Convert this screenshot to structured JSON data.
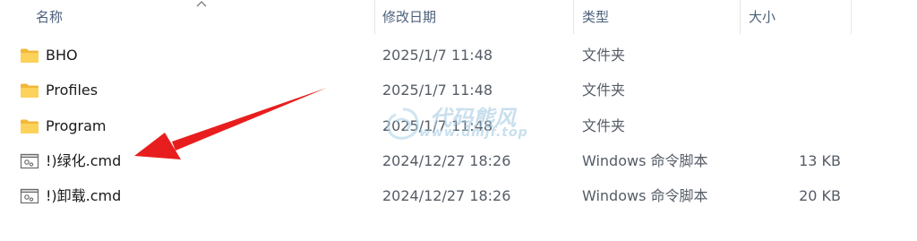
{
  "columns": {
    "name": "名称",
    "modified": "修改日期",
    "type": "类型",
    "size": "大小"
  },
  "files": [
    {
      "name": "BHO",
      "modified": "2025/1/7 11:48",
      "type": "文件夹",
      "size": "",
      "icon": "folder-icon"
    },
    {
      "name": "Profiles",
      "modified": "2025/1/7 11:48",
      "type": "文件夹",
      "size": "",
      "icon": "folder-icon"
    },
    {
      "name": "Program",
      "modified": "2025/1/7 11:48",
      "type": "文件夹",
      "size": "",
      "icon": "folder-icon"
    },
    {
      "name": "!)绿化.cmd",
      "modified": "2024/12/27 18:26",
      "type": "Windows 命令脚本",
      "size": "13 KB",
      "icon": "cmd-script-icon"
    },
    {
      "name": "!)卸载.cmd",
      "modified": "2024/12/27 18:26",
      "type": "Windows 命令脚本",
      "size": "20 KB",
      "icon": "cmd-script-icon"
    }
  ],
  "watermark": {
    "title": "代码熊风",
    "subtitle": "www.dmjf.top"
  },
  "colors": {
    "header_text": "#4c607a",
    "folder": "#f7c948",
    "annotation_arrow": "#e81e1e"
  }
}
